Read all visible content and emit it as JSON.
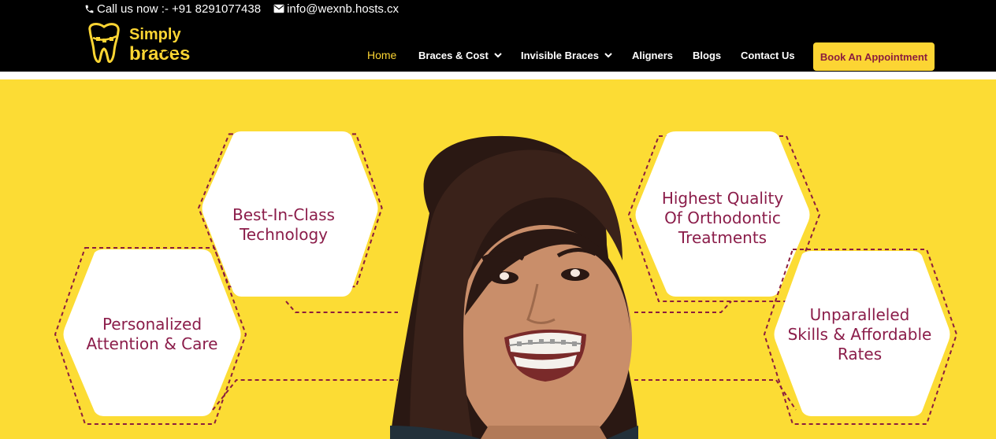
{
  "topbar": {
    "phone_text": "Call us now :- +91 8291077438",
    "email_text": "info@wexnb.hosts.cx",
    "phone_icon": "phone-icon",
    "email_icon": "envelope-icon"
  },
  "logo": {
    "line1": "Simply",
    "line2": "braces",
    "icon": "tooth-with-braces-icon"
  },
  "nav": {
    "items": [
      {
        "label": "Home",
        "active": true
      },
      {
        "label": "Braces & Cost",
        "has_dropdown": true
      },
      {
        "label": "Invisible Braces",
        "has_dropdown": true
      },
      {
        "label": "Aligners"
      },
      {
        "label": "Blogs"
      },
      {
        "label": "Contact Us"
      }
    ],
    "cta_label": "Book An Appointment"
  },
  "hero": {
    "features": [
      {
        "label": "Best-In-Class\nTechnology"
      },
      {
        "label": "Personalized\nAttention & Care"
      },
      {
        "label": "Highest Quality\nOf Orthodontic\nTreatments"
      },
      {
        "label": "Unparalleled\nSkills & Affordable\nRates"
      }
    ],
    "photo": "smiling-girl-with-braces"
  },
  "colors": {
    "header_bg": "#000000",
    "accent_yellow": "#fcd533",
    "hero_bg": "#fcdc34",
    "brand_maroon": "#8b1d3e"
  }
}
